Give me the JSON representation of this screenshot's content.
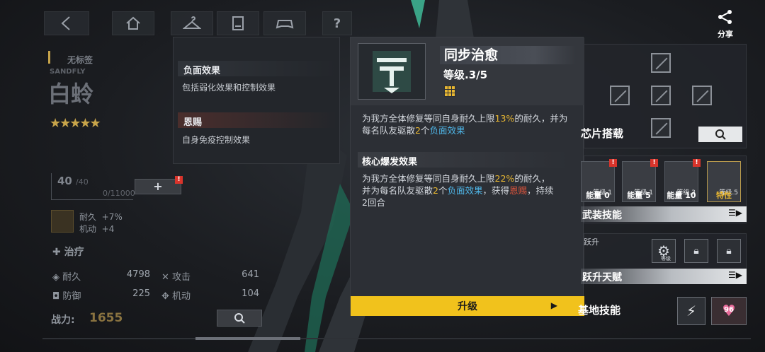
{
  "nav": {
    "share_label": "分享"
  },
  "character": {
    "tag": "无标签",
    "code_name": "SANDFLY",
    "name": "白蛉",
    "stars": "★★★★★",
    "level": "40",
    "level_max": "/40",
    "exp": "0/11000",
    "plus_label": "+",
    "bonus_durability_label": "耐久",
    "bonus_durability_value": "+7%",
    "bonus_mobility_label": "机动",
    "bonus_mobility_value": "+4",
    "role": "治疗",
    "stats": [
      {
        "label": "耐久",
        "value": "4798"
      },
      {
        "label": "攻击",
        "value": "641"
      },
      {
        "label": "防御",
        "value": "225"
      },
      {
        "label": "机动",
        "value": "104"
      }
    ],
    "power_label": "战力:",
    "power_value": "1655"
  },
  "effects": [
    {
      "title": "负面效果",
      "desc": "包括弱化效果和控制效果"
    },
    {
      "title": "恩赐",
      "desc": "自身免疫控制效果"
    }
  ],
  "skill": {
    "name": "同步治愈",
    "level": "等级.3/5",
    "desc_part1": "为我方全体修复等同自身耐久上限",
    "desc_pct1": "13%",
    "desc_part2": "的耐久，并为",
    "desc_part3": "每名队友驱散",
    "desc_num1": "2",
    "desc_part4": "个",
    "desc_kw1": "负面效果",
    "core_label": "核心爆发效果",
    "core_part1": "为我方全体修复等同自身耐久上限",
    "core_pct": "22%",
    "core_part2": "的耐久，",
    "core_part3": "并为每名队友驱散",
    "core_num": "2",
    "core_part4": "个",
    "core_kw": "负面效果",
    "core_part5": "，获得",
    "core_kw2": "恩赐",
    "core_part6": "，持续",
    "core_part7": "2回合",
    "upgrade_label": "升级",
    "highlight_colors": {
      "yellow": "#e8b732",
      "blue": "#4fb6e8",
      "red": "#e0553c"
    }
  },
  "right": {
    "chip_label": "芯片搭载",
    "skills_cards": [
      {
        "lv": "等级.1",
        "bottom": "能量 0"
      },
      {
        "lv": "等级.1",
        "bottom": "能量 5"
      },
      {
        "lv": "等级.3",
        "bottom": "能量 10"
      },
      {
        "lv": "等级.5",
        "bottom": "特性"
      }
    ],
    "armed_skills_label": "武装技能",
    "ascend_small": "跃升",
    "ascend_label": "跃升天赋",
    "ascend_lv": "等级",
    "base_skill_label": "基地技能",
    "heart_value": "96"
  }
}
